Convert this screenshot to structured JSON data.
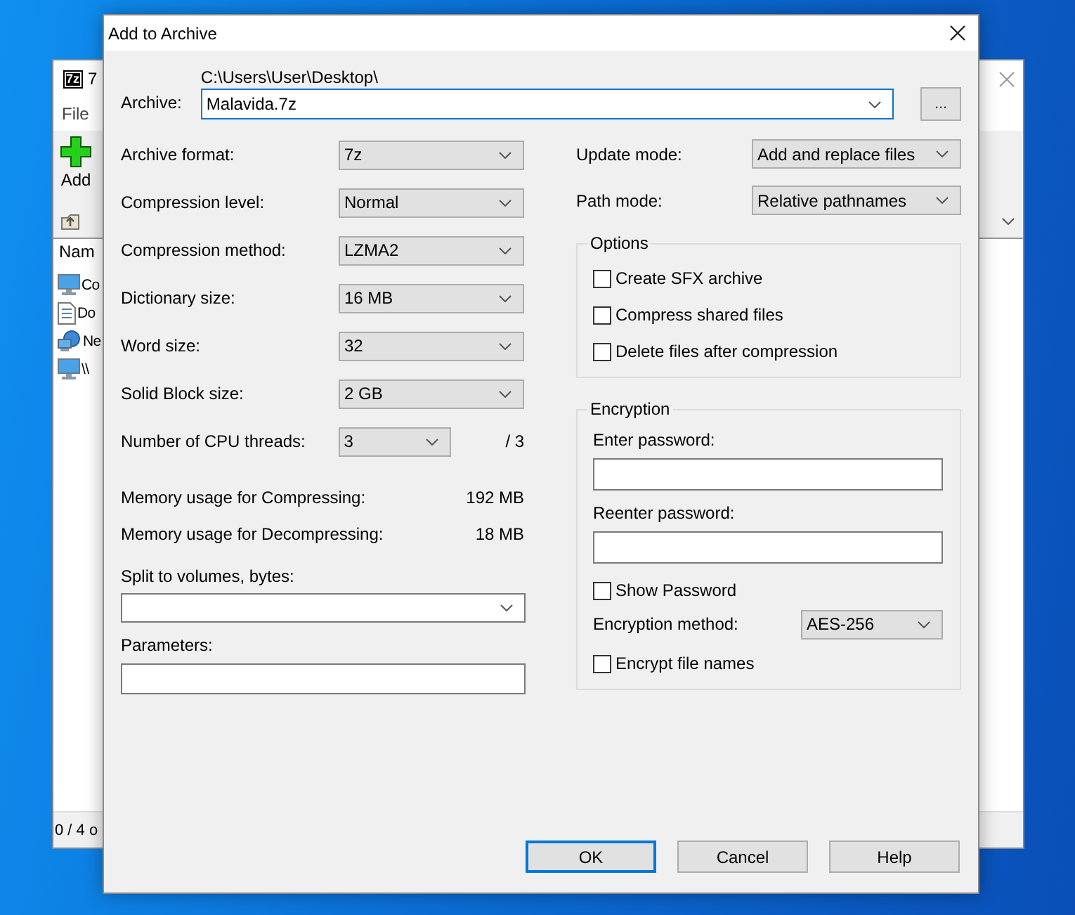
{
  "background_window": {
    "app_icon_text": "7z",
    "title": "7",
    "menu": [
      {
        "label": "File"
      }
    ],
    "toolbar": [
      {
        "label": "Add",
        "kind": "add"
      }
    ],
    "list_header": "Nam",
    "items": [
      {
        "name": "Co",
        "kind": "computer"
      },
      {
        "name": "Do",
        "kind": "document"
      },
      {
        "name": "Ne",
        "kind": "network"
      },
      {
        "name": "\\\\",
        "kind": "computer"
      }
    ],
    "status": "0 / 4 o"
  },
  "dialog": {
    "title": "Add to Archive",
    "archive": {
      "label": "Archive:",
      "path": "C:\\Users\\User\\Desktop\\",
      "value": "Malavida.7z",
      "browse": "..."
    },
    "left_settings": [
      {
        "label": "Archive format:",
        "value": "7z",
        "kind": "combo"
      },
      {
        "label": "Compression level:",
        "value": "Normal",
        "kind": "combo"
      },
      {
        "label": "Compression method:",
        "value": "LZMA2",
        "kind": "combo"
      },
      {
        "label": "Dictionary size:",
        "value": "16 MB",
        "kind": "combo"
      },
      {
        "label": "Word size:",
        "value": "32",
        "kind": "combo"
      },
      {
        "label": "Solid Block size:",
        "value": "2 GB",
        "kind": "combo"
      },
      {
        "label": "Number of CPU threads:",
        "value": "3",
        "suffix": "/ 3",
        "kind": "narrow_combo"
      }
    ],
    "memory": [
      {
        "label": "Memory usage for Compressing:",
        "value": "192 MB"
      },
      {
        "label": "Memory usage for Decompressing:",
        "value": "18 MB"
      }
    ],
    "split": {
      "label": "Split to volumes, bytes:"
    },
    "parameters": {
      "label": "Parameters:"
    },
    "right_settings": [
      {
        "label": "Update mode:",
        "value": "Add and replace files"
      },
      {
        "label": "Path mode:",
        "value": "Relative pathnames"
      }
    ],
    "options": {
      "title": "Options",
      "checkboxes": [
        {
          "label": "Create SFX archive",
          "checked": false
        },
        {
          "label": "Compress shared files",
          "checked": false
        },
        {
          "label": "Delete files after compression",
          "checked": false
        }
      ]
    },
    "encryption": {
      "title": "Encryption",
      "password_label": "Enter password:",
      "reenter_label": "Reenter password:",
      "show_password": {
        "label": "Show Password",
        "checked": false
      },
      "method_label": "Encryption method:",
      "method": "AES-256",
      "encrypt_names": {
        "label": "Encrypt file names",
        "checked": false
      }
    },
    "buttons": [
      {
        "label": "OK",
        "default": true
      },
      {
        "label": "Cancel",
        "default": false
      },
      {
        "label": "Help",
        "default": false
      }
    ]
  }
}
